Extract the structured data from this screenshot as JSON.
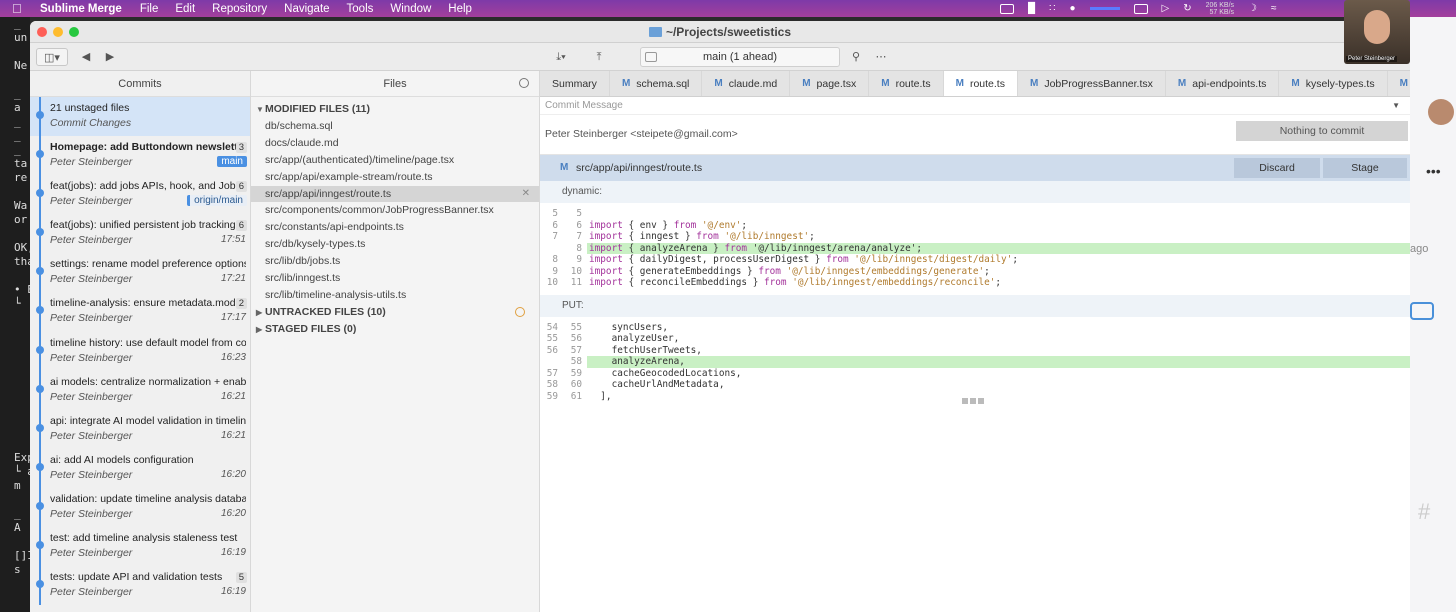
{
  "menubar": {
    "app_name": "Sublime Merge",
    "items": [
      "File",
      "Edit",
      "Repository",
      "Navigate",
      "Tools",
      "Window",
      "Help"
    ],
    "net_up": "206 KB/s",
    "net_down": "57 KB/s"
  },
  "webcam": {
    "label": "Peter Steinberger"
  },
  "window": {
    "title": "~/Projects/sweetistics"
  },
  "toolbar": {
    "branch": "main (1 ahead)"
  },
  "terminal_left": [
    "_",
    "un",
    "",
    "Ne",
    "",
    "_",
    "a",
    "_",
    "_",
    "_",
    "ta",
    "re",
    "",
    "Wa",
    "or",
    "",
    "OK,",
    "tha",
    "",
    "• Ex",
    "  └",
    "",
    "",
    "",
    "",
    "",
    "",
    "",
    "",
    "",
    "",
    "Exp",
    "└ a",
    "  m",
    "",
    "  _",
    "  A",
    "",
    "[]Im",
    "  s"
  ],
  "terminal_right": {
    "ago": "ago"
  },
  "commits": {
    "header": "Commits",
    "rows": [
      {
        "msg": "21 unstaged files",
        "sub": "Commit Changes",
        "sub_italic": true,
        "time": "",
        "count": "",
        "tag": "",
        "tag_type": "",
        "selected": true,
        "bold": false
      },
      {
        "msg": "Homepage: add Buttondown newsletter",
        "sub": "Peter Steinberger",
        "time": "",
        "count": "3",
        "tag": "main",
        "tag_type": "local",
        "selected": false,
        "bold": true
      },
      {
        "msg": "feat(jobs): add jobs APIs, hook, and JobPr",
        "sub": "Peter Steinberger",
        "time": "",
        "count": "6",
        "tag": "origin/main",
        "tag_type": "remote",
        "selected": false,
        "bold": false
      },
      {
        "msg": "feat(jobs): unified persistent job tracking v",
        "sub": "Peter Steinberger",
        "time": "17:51",
        "count": "6",
        "tag": "",
        "tag_type": "",
        "selected": false,
        "bold": false
      },
      {
        "msg": "settings: rename model preference options to",
        "sub": "Peter Steinberger",
        "time": "17:21",
        "count": "",
        "tag": "",
        "tag_type": "",
        "selected": false,
        "bold": false
      },
      {
        "msg": "timeline-analysis: ensure metadata.model",
        "sub": "Peter Steinberger",
        "time": "17:17",
        "count": "2",
        "tag": "",
        "tag_type": "",
        "selected": false,
        "bold": false
      },
      {
        "msg": "timeline history: use default model from confi",
        "sub": "Peter Steinberger",
        "time": "16:23",
        "count": "",
        "tag": "",
        "tag_type": "",
        "selected": false,
        "bold": false
      },
      {
        "msg": "ai models: centralize normalization + enablem",
        "sub": "Peter Steinberger",
        "time": "16:21",
        "count": "",
        "tag": "",
        "tag_type": "",
        "selected": false,
        "bold": false
      },
      {
        "msg": "api: integrate AI model validation in timeline a",
        "sub": "Peter Steinberger",
        "time": "16:21",
        "count": "",
        "tag": "",
        "tag_type": "",
        "selected": false,
        "bold": false
      },
      {
        "msg": "ai: add AI models configuration",
        "sub": "Peter Steinberger",
        "time": "16:20",
        "count": "",
        "tag": "",
        "tag_type": "",
        "selected": false,
        "bold": false
      },
      {
        "msg": "validation: update timeline analysis database",
        "sub": "Peter Steinberger",
        "time": "16:20",
        "count": "",
        "tag": "",
        "tag_type": "",
        "selected": false,
        "bold": false
      },
      {
        "msg": "test: add timeline analysis staleness test",
        "sub": "Peter Steinberger",
        "time": "16:19",
        "count": "",
        "tag": "",
        "tag_type": "",
        "selected": false,
        "bold": false
      },
      {
        "msg": "tests: update API and validation tests",
        "sub": "Peter Steinberger",
        "time": "16:19",
        "count": "5",
        "tag": "",
        "tag_type": "",
        "selected": false,
        "bold": false
      }
    ]
  },
  "files": {
    "header": "Files",
    "modified_header": "MODIFIED FILES (11)",
    "modified": [
      "db/schema.sql",
      "docs/claude.md",
      "src/app/(authenticated)/timeline/page.tsx",
      "src/app/api/example-stream/route.ts",
      "src/app/api/inngest/route.ts",
      "src/components/common/JobProgressBanner.tsx",
      "src/constants/api-endpoints.ts",
      "src/db/kysely-types.ts",
      "src/lib/db/jobs.ts",
      "src/lib/inngest.ts",
      "src/lib/timeline-analysis-utils.ts"
    ],
    "selected_index": 4,
    "untracked_header": "UNTRACKED FILES (10)",
    "staged_header": "STAGED FILES (0)"
  },
  "tabs": [
    {
      "label": "Summary",
      "m": false,
      "active": false
    },
    {
      "label": "schema.sql",
      "m": true,
      "active": false
    },
    {
      "label": "claude.md",
      "m": true,
      "active": false
    },
    {
      "label": "page.tsx",
      "m": true,
      "active": false
    },
    {
      "label": "route.ts",
      "m": true,
      "active": false
    },
    {
      "label": "route.ts",
      "m": true,
      "active": true
    },
    {
      "label": "JobProgressBanner.tsx",
      "m": true,
      "active": false
    },
    {
      "label": "api-endpoints.ts",
      "m": true,
      "active": false
    },
    {
      "label": "kysely-types.ts",
      "m": true,
      "active": false
    },
    {
      "label": "job",
      "m": true,
      "active": false
    }
  ],
  "commit_box": {
    "placeholder": "Commit Message",
    "author": "Peter Steinberger <steipete@gmail.com>",
    "nothing_label": "Nothing to commit"
  },
  "diff": {
    "file_marker": "M",
    "file_path": "src/app/api/inngest/route.ts",
    "discard_label": "Discard",
    "stage_label": "Stage",
    "hunks": [
      {
        "header": "dynamic:",
        "lines": [
          {
            "ln1": "5",
            "ln2": "5",
            "type": "ctx",
            "parts": []
          },
          {
            "ln1": "6",
            "ln2": "6",
            "type": "ctx",
            "parts": [
              [
                "kw",
                "import"
              ],
              [
                "p",
                " { env } "
              ],
              [
                "kw",
                "from"
              ],
              [
                "str",
                " '@/env'"
              ],
              [
                "p",
                ";"
              ]
            ]
          },
          {
            "ln1": "7",
            "ln2": "7",
            "type": "ctx",
            "parts": [
              [
                "kw",
                "import"
              ],
              [
                "p",
                " { inngest } "
              ],
              [
                "kw",
                "from"
              ],
              [
                "str",
                " '@/lib/inngest'"
              ],
              [
                "p",
                ";"
              ]
            ]
          },
          {
            "ln1": "",
            "ln2": "8",
            "type": "add",
            "parts": [
              [
                "kw",
                "import"
              ],
              [
                "p",
                " { analyzeArena } "
              ],
              [
                "kw",
                "from"
              ],
              [
                "p",
                " '@/lib/inngest/arena/analyze';"
              ]
            ]
          },
          {
            "ln1": "8",
            "ln2": "9",
            "type": "ctx",
            "parts": [
              [
                "kw",
                "import"
              ],
              [
                "p",
                " { dailyDigest, processUserDigest } "
              ],
              [
                "kw",
                "from"
              ],
              [
                "str",
                " '@/lib/inngest/digest/daily'"
              ],
              [
                "p",
                ";"
              ]
            ]
          },
          {
            "ln1": "9",
            "ln2": "10",
            "type": "ctx",
            "parts": [
              [
                "kw",
                "import"
              ],
              [
                "p",
                " { generateEmbeddings } "
              ],
              [
                "kw",
                "from"
              ],
              [
                "str",
                " '@/lib/inngest/embeddings/generate'"
              ],
              [
                "p",
                ";"
              ]
            ]
          },
          {
            "ln1": "10",
            "ln2": "11",
            "type": "ctx",
            "parts": [
              [
                "kw",
                "import"
              ],
              [
                "p",
                " { reconcileEmbeddings } "
              ],
              [
                "kw",
                "from"
              ],
              [
                "str",
                " '@/lib/inngest/embeddings/reconcile'"
              ],
              [
                "p",
                ";"
              ]
            ]
          }
        ]
      },
      {
        "header": "PUT:",
        "lines": [
          {
            "ln1": "54",
            "ln2": "55",
            "type": "ctx",
            "parts": [
              [
                "p",
                "    syncUsers,"
              ]
            ]
          },
          {
            "ln1": "55",
            "ln2": "56",
            "type": "ctx",
            "parts": [
              [
                "p",
                "    analyzeUser,"
              ]
            ]
          },
          {
            "ln1": "56",
            "ln2": "57",
            "type": "ctx",
            "parts": [
              [
                "p",
                "    fetchUserTweets,"
              ]
            ]
          },
          {
            "ln1": "",
            "ln2": "58",
            "type": "add",
            "parts": [
              [
                "p",
                "    analyzeArena,"
              ]
            ]
          },
          {
            "ln1": "57",
            "ln2": "59",
            "type": "ctx",
            "parts": [
              [
                "p",
                "    cacheGeocodedLocations,"
              ]
            ]
          },
          {
            "ln1": "58",
            "ln2": "60",
            "type": "ctx",
            "parts": [
              [
                "p",
                "    cacheUrlAndMetadata,"
              ]
            ]
          },
          {
            "ln1": "59",
            "ln2": "61",
            "type": "ctx",
            "parts": [
              [
                "p",
                "  ],"
              ]
            ]
          }
        ]
      }
    ]
  }
}
